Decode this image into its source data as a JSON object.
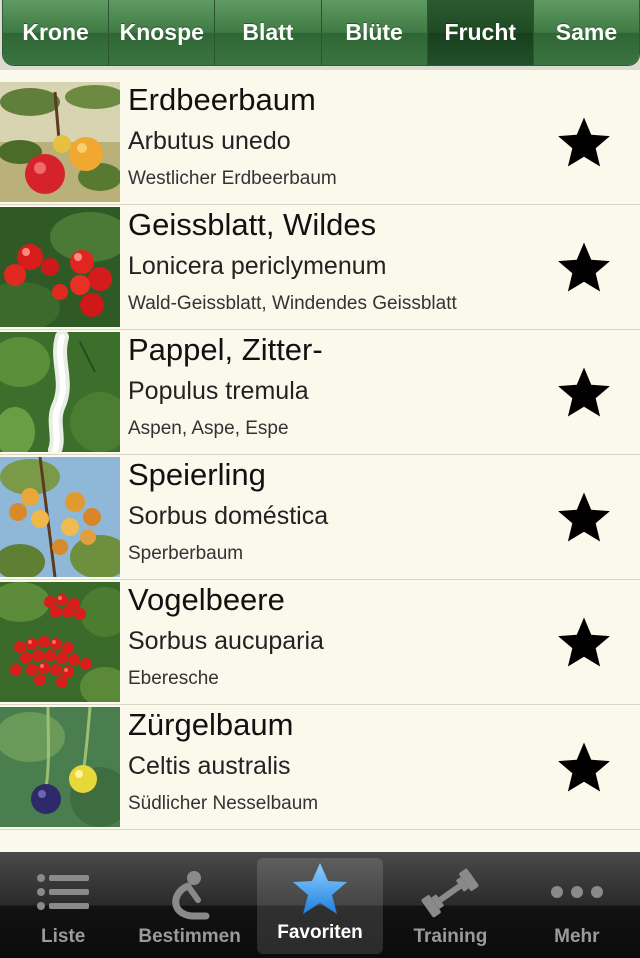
{
  "segments": [
    {
      "label": "Krone",
      "selected": false
    },
    {
      "label": "Knospe",
      "selected": false
    },
    {
      "label": "Blatt",
      "selected": false
    },
    {
      "label": "Blüte",
      "selected": false
    },
    {
      "label": "Frucht",
      "selected": true
    },
    {
      "label": "Same",
      "selected": false
    }
  ],
  "plants": [
    {
      "name": "Erdbeerbaum",
      "latin": "Arbutus unedo",
      "alt": "Westlicher Erdbeerbaum",
      "favorite_icon": "star-icon"
    },
    {
      "name": "Geissblatt, Wildes",
      "latin": "Lonicera periclymenum",
      "alt": "Wald-Geissblatt, Windendes Geissblatt",
      "favorite_icon": "star-icon"
    },
    {
      "name": "Pappel, Zitter-",
      "latin": "Populus tremula",
      "alt": "Aspen, Aspe, Espe",
      "favorite_icon": "star-icon"
    },
    {
      "name": "Speierling",
      "latin": "Sorbus doméstica",
      "alt": "Sperberbaum",
      "favorite_icon": "star-icon"
    },
    {
      "name": "Vogelbeere",
      "latin": "Sorbus aucuparia",
      "alt": "Eberesche",
      "favorite_icon": "star-icon"
    },
    {
      "name": "Zürgelbaum",
      "latin": "Celtis australis",
      "alt": "Südlicher Nesselbaum",
      "favorite_icon": "star-icon"
    }
  ],
  "tabbar": {
    "tabs": [
      {
        "label": "Liste",
        "icon": "list-icon",
        "selected": false
      },
      {
        "label": "Bestimmen",
        "icon": "identify-icon",
        "selected": false
      },
      {
        "label": "Favoriten",
        "icon": "star-icon",
        "selected": true
      },
      {
        "label": "Training",
        "icon": "dumbbell-icon",
        "selected": false
      },
      {
        "label": "Mehr",
        "icon": "more-icon",
        "selected": false
      }
    ]
  },
  "colors": {
    "segment_green": "#3f7a44",
    "segment_selected": "#1f4a24",
    "list_background": "#fbf8ec",
    "tab_selected_blue": "#3fa0ef"
  }
}
